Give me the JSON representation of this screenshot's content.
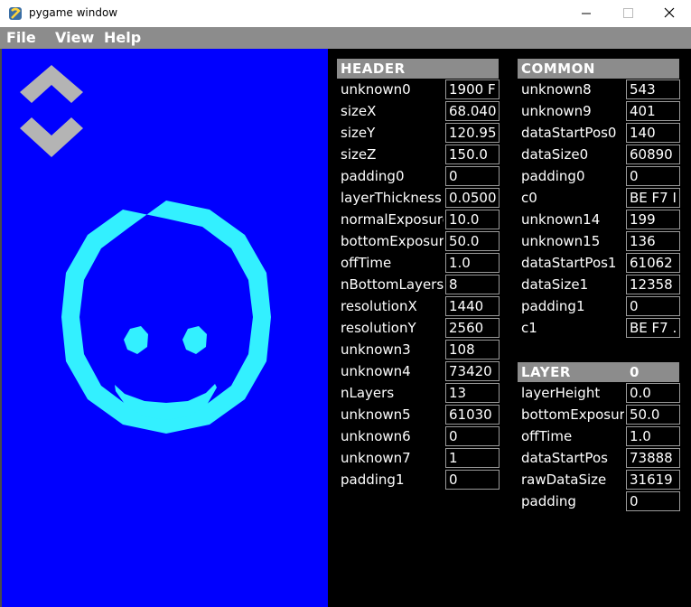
{
  "window": {
    "title": "pygame window"
  },
  "menu": {
    "file": "File",
    "view": "View",
    "help": "Help"
  },
  "header": {
    "title": "HEADER",
    "fields": [
      {
        "label": "unknown0",
        "value": "1900 F"
      },
      {
        "label": "sizeX",
        "value": "68.040"
      },
      {
        "label": "sizeY",
        "value": "120.95"
      },
      {
        "label": "sizeZ",
        "value": "150.0"
      },
      {
        "label": "padding0",
        "value": "0"
      },
      {
        "label": "layerThickness",
        "value": "0.0500"
      },
      {
        "label": "normalExposure",
        "value": "10.0"
      },
      {
        "label": "bottomExposure",
        "value": "50.0"
      },
      {
        "label": "offTime",
        "value": "1.0"
      },
      {
        "label": "nBottomLayers",
        "value": "8"
      },
      {
        "label": "resolutionX",
        "value": "1440"
      },
      {
        "label": "resolutionY",
        "value": "2560"
      },
      {
        "label": "unknown3",
        "value": "108"
      },
      {
        "label": "unknown4",
        "value": "73420"
      },
      {
        "label": "nLayers",
        "value": "13"
      },
      {
        "label": "unknown5",
        "value": "61030"
      },
      {
        "label": "unknown6",
        "value": "0"
      },
      {
        "label": "unknown7",
        "value": "1"
      },
      {
        "label": "padding1",
        "value": "0"
      }
    ]
  },
  "common": {
    "title": "COMMON",
    "fields": [
      {
        "label": "unknown8",
        "value": "543"
      },
      {
        "label": "unknown9",
        "value": "401"
      },
      {
        "label": "dataStartPos0",
        "value": "140"
      },
      {
        "label": "dataSize0",
        "value": "60890"
      },
      {
        "label": "padding0",
        "value": "0"
      },
      {
        "label": "c0",
        "value": "BE F7 I"
      },
      {
        "label": "unknown14",
        "value": "199"
      },
      {
        "label": "unknown15",
        "value": "136"
      },
      {
        "label": "dataStartPos1",
        "value": "61062"
      },
      {
        "label": "dataSize1",
        "value": "12358"
      },
      {
        "label": "padding1",
        "value": "0"
      },
      {
        "label": "c1",
        "value": "BE F7 ."
      }
    ]
  },
  "layer": {
    "title": "LAYER",
    "index": "0",
    "fields": [
      {
        "label": "layerHeight",
        "value": "0.0"
      },
      {
        "label": "bottomExposure",
        "value": "50.0"
      },
      {
        "label": "offTime",
        "value": "1.0"
      },
      {
        "label": "dataStartPos",
        "value": "73888"
      },
      {
        "label": "rawDataSize",
        "value": "31619"
      },
      {
        "label": "padding",
        "value": "0"
      }
    ]
  },
  "colors": {
    "preview_bg": "#0000ff",
    "smiley": "#33f0ff",
    "nav_arrows": "#b4b4b4",
    "panel_bg": "#000000",
    "section_header": "#8c8c8c",
    "menubar": "#8c8c8c"
  },
  "icons": {
    "app": "pygame-snake-icon",
    "nav_up": "chevron-up-icon",
    "nav_down": "chevron-down-icon"
  }
}
